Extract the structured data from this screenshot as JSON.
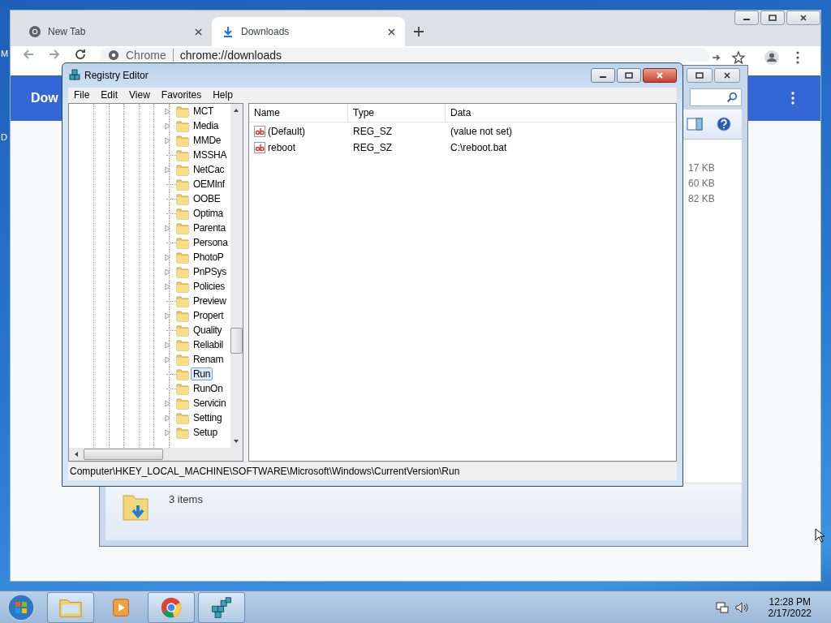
{
  "desktop": {
    "labels": [
      "M",
      "D"
    ]
  },
  "browser": {
    "tabs": [
      {
        "title": "New Tab",
        "selected": false,
        "kind": "chrome"
      },
      {
        "title": "Downloads",
        "selected": true,
        "kind": "download"
      }
    ],
    "omnibox": {
      "site": "Chrome",
      "url": "chrome://downloads"
    },
    "page_title": "Dow"
  },
  "explorer": {
    "sizes": [
      "17 KB",
      "60 KB",
      "82 KB"
    ],
    "status": "3 items"
  },
  "regedit": {
    "title": "Registry Editor",
    "menu": [
      "File",
      "Edit",
      "View",
      "Favorites",
      "Help"
    ],
    "tree": [
      {
        "label": "MCT",
        "has_children": true,
        "selected": false
      },
      {
        "label": "Media",
        "has_children": true,
        "selected": false
      },
      {
        "label": "MMDe",
        "has_children": true,
        "selected": false
      },
      {
        "label": "MSSHA",
        "has_children": false,
        "selected": false
      },
      {
        "label": "NetCac",
        "has_children": true,
        "selected": false
      },
      {
        "label": "OEMInf",
        "has_children": false,
        "selected": false
      },
      {
        "label": "OOBE",
        "has_children": false,
        "selected": false
      },
      {
        "label": "Optima",
        "has_children": false,
        "selected": false
      },
      {
        "label": "Parenta",
        "has_children": true,
        "selected": false
      },
      {
        "label": "Persona",
        "has_children": false,
        "selected": false
      },
      {
        "label": "PhotoP",
        "has_children": true,
        "selected": false
      },
      {
        "label": "PnPSys",
        "has_children": true,
        "selected": false
      },
      {
        "label": "Policies",
        "has_children": true,
        "selected": false
      },
      {
        "label": "Preview",
        "has_children": false,
        "selected": false
      },
      {
        "label": "Propert",
        "has_children": true,
        "selected": false
      },
      {
        "label": "Quality",
        "has_children": false,
        "selected": false
      },
      {
        "label": "Reliabil",
        "has_children": true,
        "selected": false
      },
      {
        "label": "Renam",
        "has_children": true,
        "selected": false
      },
      {
        "label": "Run",
        "has_children": false,
        "selected": true
      },
      {
        "label": "RunOn",
        "has_children": false,
        "selected": false
      },
      {
        "label": "Servicin",
        "has_children": true,
        "selected": false
      },
      {
        "label": "Setting",
        "has_children": true,
        "selected": false
      },
      {
        "label": "Setup",
        "has_children": true,
        "selected": false
      }
    ],
    "columns": [
      "Name",
      "Type",
      "Data"
    ],
    "values": [
      {
        "name": "(Default)",
        "type": "REG_SZ",
        "data": "(value not set)"
      },
      {
        "name": "reboot",
        "type": "REG_SZ",
        "data": "C:\\reboot.bat"
      }
    ],
    "path": "Computer\\HKEY_LOCAL_MACHINE\\SOFTWARE\\Microsoft\\Windows\\CurrentVersion\\Run"
  },
  "taskbar": {
    "apps": [
      {
        "kind": "explorer",
        "running": true
      },
      {
        "kind": "media",
        "running": false
      },
      {
        "kind": "chrome",
        "running": true
      },
      {
        "kind": "regedit",
        "running": true
      }
    ],
    "time": "12:28 PM",
    "date": "2/17/2022"
  }
}
